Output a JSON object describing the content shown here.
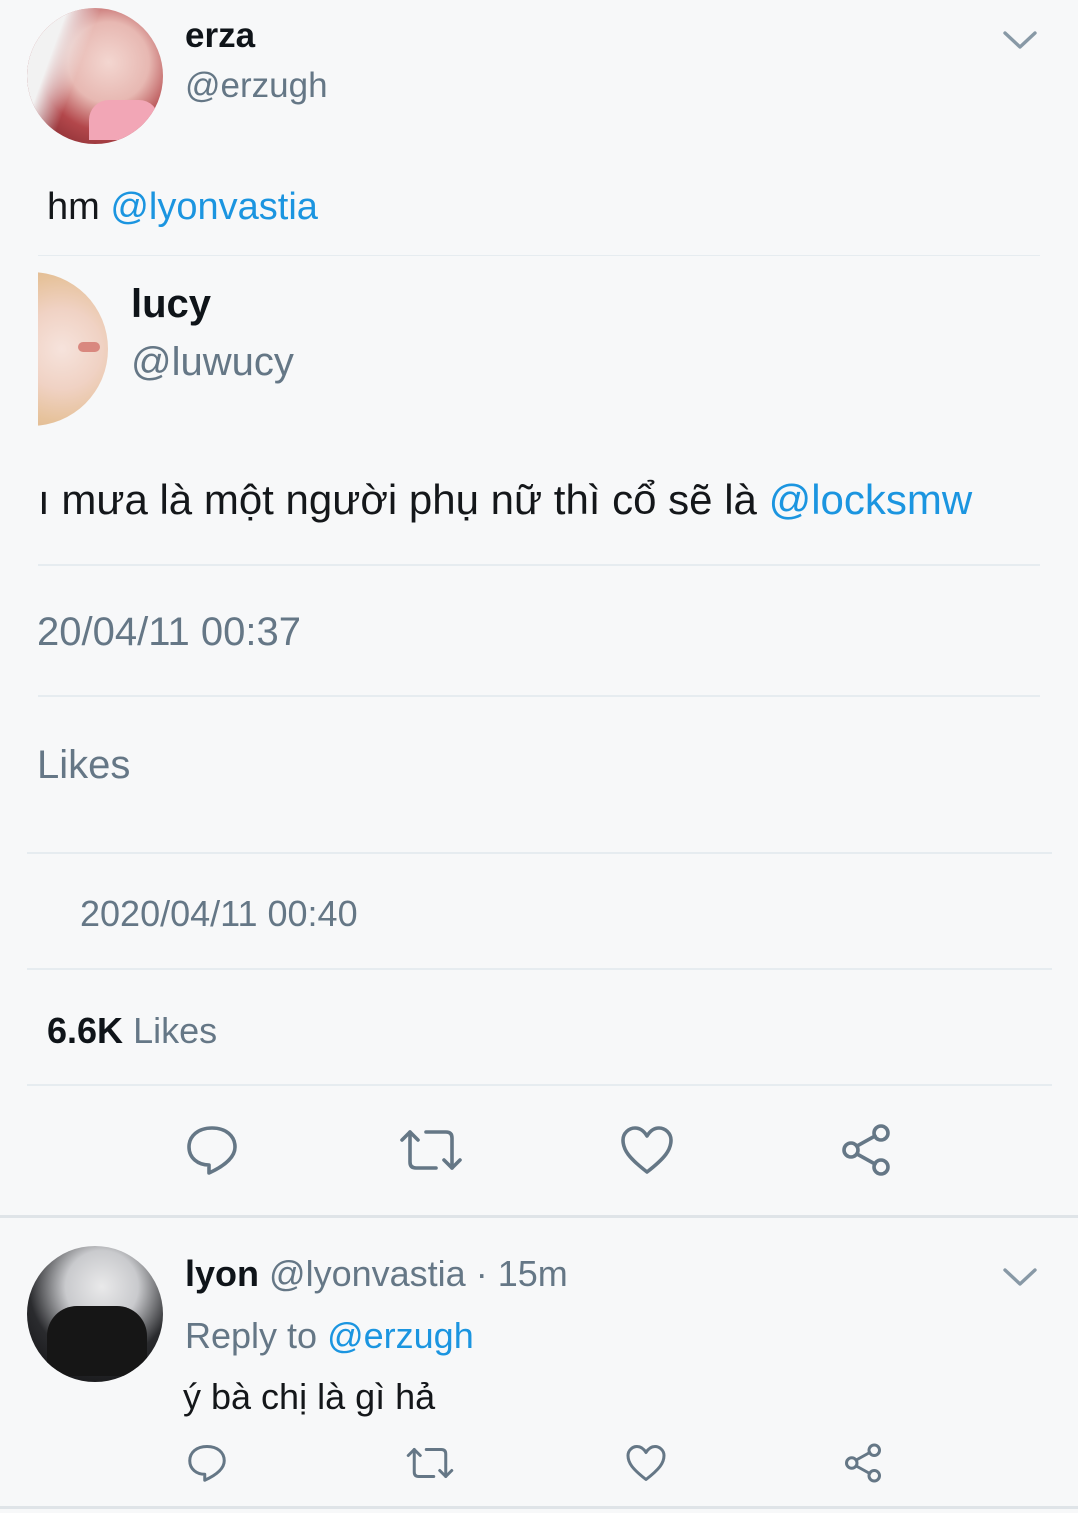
{
  "tweet": {
    "author_name": "erza",
    "author_handle": "@erzugh",
    "text_prefix": "hm ",
    "text_mention": "@lyonvastia",
    "quoted": {
      "author_name": "lucy",
      "author_handle": "@luwucy",
      "text": "mưa là một người phụ nữ thì cổ sẽ là ",
      "text_mention": "@locksmw",
      "timestamp": "20/04/11 00:37",
      "likes_label": "Likes"
    },
    "timestamp": "2020/04/11 00:40",
    "likes_count": "6.6K",
    "likes_label": "Likes",
    "actions": [
      "reply-icon",
      "retweet-icon",
      "like-icon",
      "share-icon"
    ]
  },
  "reply": {
    "author_name": "lyon",
    "author_handle": "@lyonvastia",
    "separator": "·",
    "time": "15m",
    "reply_to_label": "Reply to",
    "reply_to_handle": "@erzugh",
    "text": "ý bà chị là gì hả"
  },
  "colors": {
    "background": "#f7f8f9",
    "link": "#1b95e0",
    "secondary_text": "#657786",
    "divider": "#e6ecf0"
  }
}
